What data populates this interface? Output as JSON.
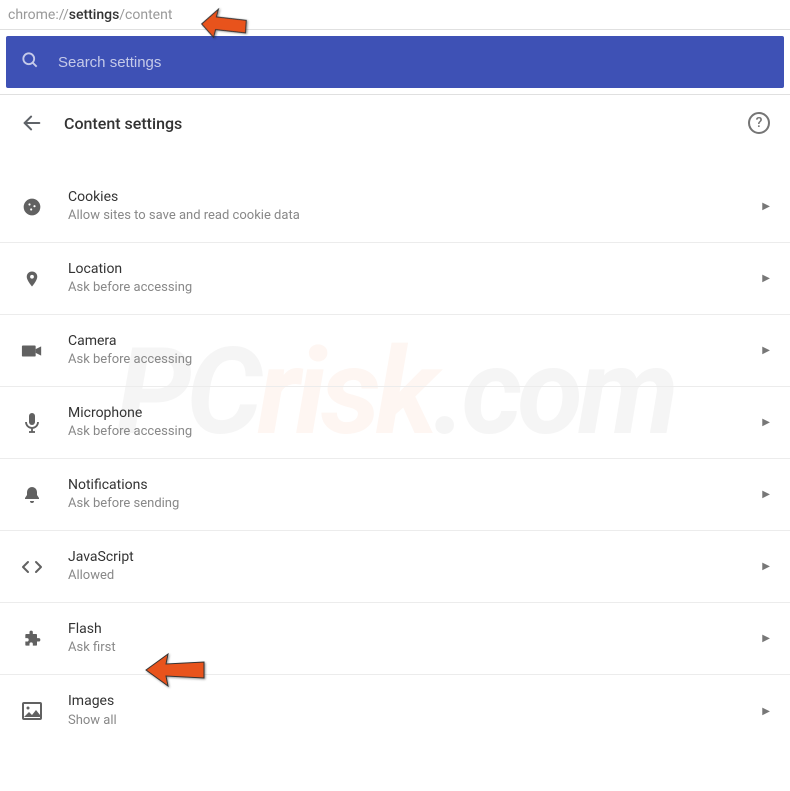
{
  "address": {
    "pre": "chrome://",
    "bold": "settings",
    "post": "/content"
  },
  "search": {
    "placeholder": "Search settings"
  },
  "header": {
    "title": "Content settings"
  },
  "items": [
    {
      "icon": "cookie",
      "title": "Cookies",
      "sub": "Allow sites to save and read cookie data"
    },
    {
      "icon": "location",
      "title": "Location",
      "sub": "Ask before accessing"
    },
    {
      "icon": "camera",
      "title": "Camera",
      "sub": "Ask before accessing"
    },
    {
      "icon": "microphone",
      "title": "Microphone",
      "sub": "Ask before accessing"
    },
    {
      "icon": "notifications",
      "title": "Notifications",
      "sub": "Ask before sending"
    },
    {
      "icon": "javascript",
      "title": "JavaScript",
      "sub": "Allowed"
    },
    {
      "icon": "flash",
      "title": "Flash",
      "sub": "Ask first"
    },
    {
      "icon": "images",
      "title": "Images",
      "sub": "Show all"
    }
  ],
  "watermark": {
    "p1": "PC",
    "p2": "risk",
    "p3": ".com"
  }
}
